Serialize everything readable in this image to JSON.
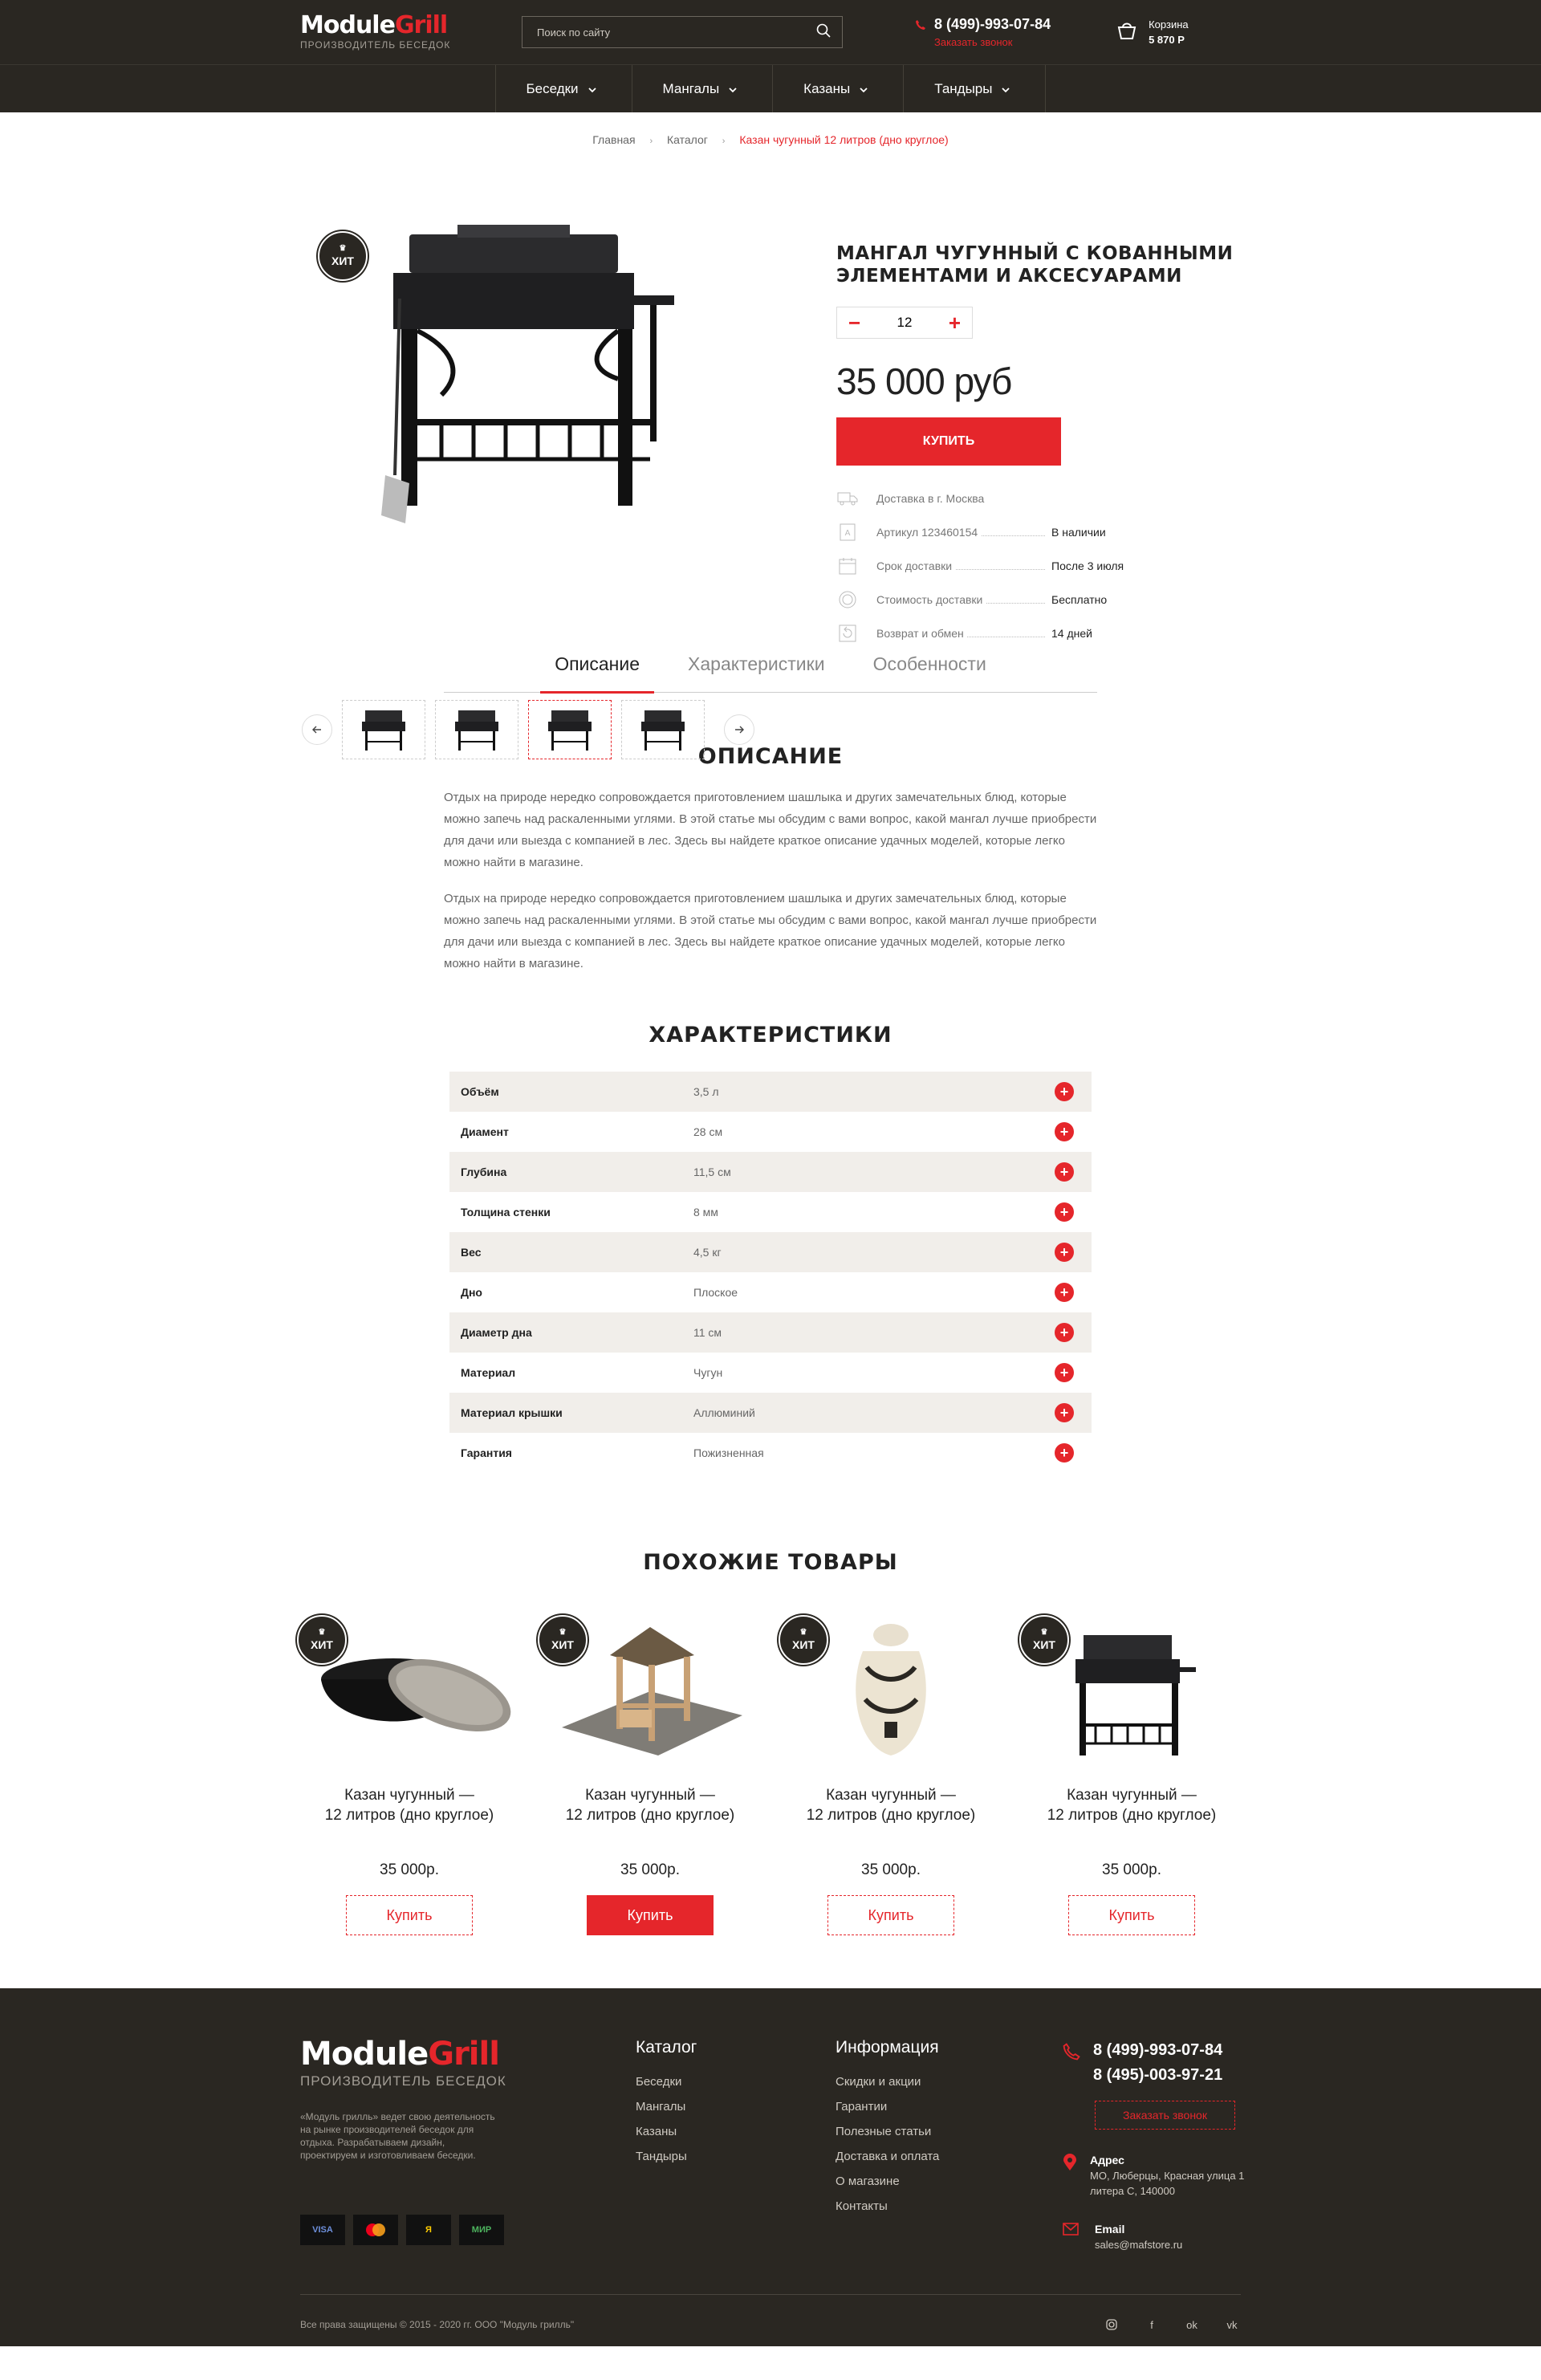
{
  "header": {
    "logo_main": "Module",
    "logo_accent": "Grill",
    "logo_sub": "ПРОИЗВОДИТЕЛЬ БЕСЕДОК",
    "search_placeholder": "Поиск по сайту",
    "phone": "8 (499)-993-07-84",
    "callback": "Заказать звонок",
    "cart_label": "Корзина",
    "cart_sum": "5 870 Р"
  },
  "nav": [
    {
      "label": "Беседки"
    },
    {
      "label": "Мангалы"
    },
    {
      "label": "Казаны"
    },
    {
      "label": "Тандыры"
    }
  ],
  "breadcrumb": {
    "home": "Главная",
    "catalog": "Каталог",
    "current": "Казан чугунный 12 литров (дно круглое)"
  },
  "product": {
    "badge": "ХИТ",
    "title": "Мангал чугунный с кованными элементами и аксесуарами",
    "qty": "12",
    "price": "35 000 руб",
    "buy": "Купить",
    "props": [
      {
        "icon": "truck-icon",
        "label": "Доставка в г. Москва",
        "value": ""
      },
      {
        "icon": "article-icon",
        "label": "Артикул 123460154",
        "value": "В наличии"
      },
      {
        "icon": "calendar-icon",
        "label": "Срок доставки",
        "value": "После 3 июля"
      },
      {
        "icon": "coin-icon",
        "label": "Стоимость доставки",
        "value": "Бесплатно"
      },
      {
        "icon": "return-icon",
        "label": "Возврат и обмен",
        "value": "14 дней"
      }
    ]
  },
  "tabs": [
    {
      "label": "Описание"
    },
    {
      "label": "Характеристики"
    },
    {
      "label": "Особенности"
    }
  ],
  "description": {
    "title": "Описание",
    "p1": "Отдых на природе нередко сопровождается приготовлением шашлыка и других замечательных блюд, которые можно запечь над раскаленными углями. В этой статье мы обсудим с вами вопрос, какой мангал лучше приобрести для дачи или выезда с компанией в лес. Здесь вы найдете краткое описание удачных моделей, которые легко можно найти в магазине.",
    "p2": "Отдых на природе нередко сопровождается приготовлением шашлыка и других замечательных блюд, которые можно запечь над раскаленными углями. В этой статье мы обсудим с вами вопрос, какой мангал лучше приобрести для дачи или выезда с компанией в лес. Здесь вы найдете краткое описание удачных моделей, которые легко можно найти в магазине."
  },
  "specs": {
    "title": "Характеристики",
    "rows": [
      {
        "name": "Объём",
        "value": "3,5 л"
      },
      {
        "name": "Диамент",
        "value": "28 см"
      },
      {
        "name": "Глубина",
        "value": "11,5 см"
      },
      {
        "name": "Толщина стенки",
        "value": "8 мм"
      },
      {
        "name": "Вес",
        "value": "4,5 кг"
      },
      {
        "name": "Дно",
        "value": "Плоское"
      },
      {
        "name": "Диаметр дна",
        "value": "11 см"
      },
      {
        "name": "Материал",
        "value": "Чугун"
      },
      {
        "name": "Материал крышки",
        "value": "Аллюминий"
      },
      {
        "name": "Гарантия",
        "value": "Пожизненная"
      }
    ]
  },
  "similar": {
    "title": "Похожие товары",
    "items": [
      {
        "badge": "ХИТ",
        "title1": "Казан чугунный —",
        "title2": "12 литров (дно круглое)",
        "price": "35 000р.",
        "button": "Купить"
      },
      {
        "badge": "ХИТ",
        "title1": "Казан чугунный —",
        "title2": "12 литров (дно круглое)",
        "price": "35 000р.",
        "button": "Купить"
      },
      {
        "badge": "ХИТ",
        "title1": "Казан чугунный —",
        "title2": "12 литров (дно круглое)",
        "price": "35 000р.",
        "button": "Купить"
      },
      {
        "badge": "ХИТ",
        "title1": "Казан чугунный —",
        "title2": "12 литров (дно круглое)",
        "price": "35 000р.",
        "button": "Купить"
      }
    ]
  },
  "footer": {
    "about": "«Модуль грилль» ведет свою деятельность на рынке производителей беседок для отдыха. Разрабатываем дизайн, проектируем и изготовливаем беседки.",
    "payments": [
      "VISA",
      "MC",
      "Я",
      "МИР"
    ],
    "catalog_title": "Каталог",
    "catalog": [
      "Беседки",
      "Мангалы",
      "Казаны",
      "Тандыры"
    ],
    "info_title": "Информация",
    "info": [
      "Скидки и акции",
      "Гарантии",
      "Полезные статьи",
      "Доставка и оплата",
      "О магазине",
      "Контакты"
    ],
    "phone1": "8 (499)-993-07-84",
    "phone2": "8 (495)-003-97-21",
    "callback": "Заказать звонок",
    "address_label": "Адрес",
    "address": "МО, Люберцы, Красная улица 1 литера С, 140000",
    "email_label": "Email",
    "email": "sales@mafstore.ru",
    "copyright": "Все права защищены © 2015 - 2020 гг. ООО \"Модуль грилль\"",
    "socials": [
      "instagram-icon",
      "facebook-icon",
      "odnoklassniki-icon",
      "vk-icon"
    ]
  },
  "colors": {
    "accent": "#e5262b",
    "dark": "#2a2722"
  }
}
